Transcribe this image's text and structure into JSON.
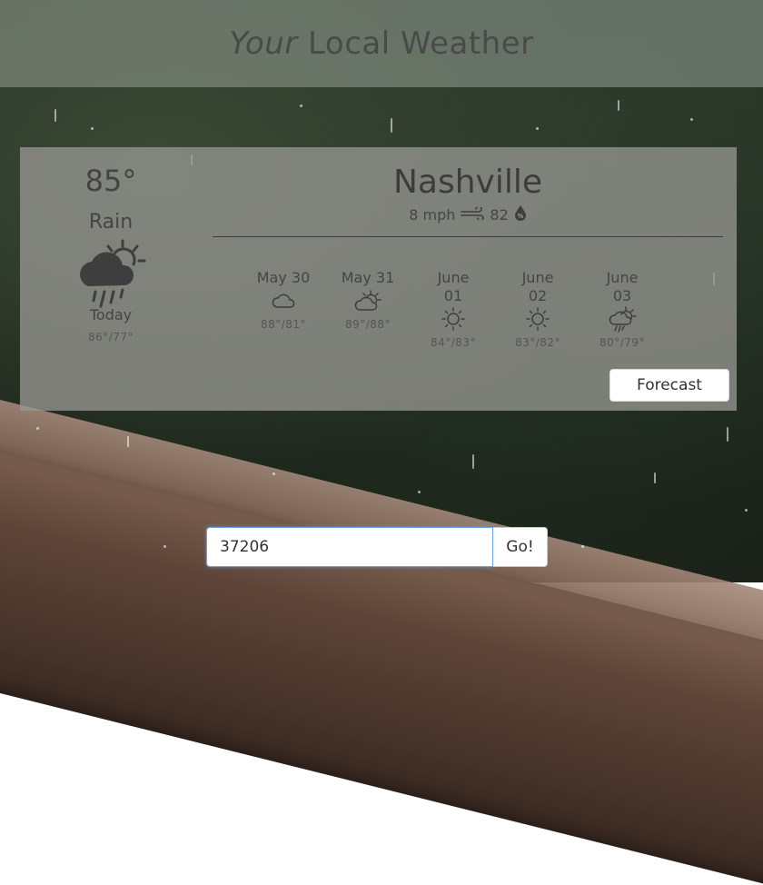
{
  "header": {
    "title_italic": "Your",
    "title_rest": "Local Weather"
  },
  "current": {
    "temperature": "85°",
    "condition": "Rain",
    "icon": "rain-cloud-icon",
    "label": "Today",
    "range": "86°/77°"
  },
  "location": {
    "city": "Nashville",
    "wind": "8 mph",
    "humidity": "82"
  },
  "forecast": [
    {
      "day_line1": "May 30",
      "day_line2": "",
      "range": "88°/81°",
      "icon": "cloud-icon"
    },
    {
      "day_line1": "May 31",
      "day_line2": "",
      "range": "89°/88°",
      "icon": "partly-cloudy-icon"
    },
    {
      "day_line1": "June",
      "day_line2": "01",
      "range": "84°/83°",
      "icon": "sun-icon"
    },
    {
      "day_line1": "June",
      "day_line2": "02",
      "range": "83°/82°",
      "icon": "sun-icon"
    },
    {
      "day_line1": "June",
      "day_line2": "03",
      "range": "80°/79°",
      "icon": "sun-rain-icon"
    }
  ],
  "forecast_button": "Forecast",
  "search": {
    "value": "37206",
    "button": "Go!"
  }
}
